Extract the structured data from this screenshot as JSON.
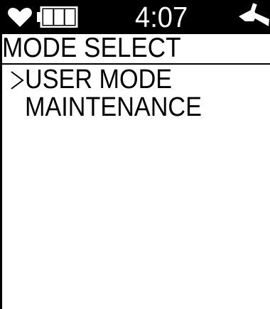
{
  "status_bar": {
    "time": "4:07",
    "icons": {
      "heart": "heart-icon",
      "battery": "battery-icon",
      "signal": "signal-icon"
    },
    "battery_level_bars": 3,
    "battery_level_max": 3
  },
  "screen": {
    "title": "MODE SELECT",
    "menu": [
      {
        "label": "USER MODE",
        "selected": true
      },
      {
        "label": "MAINTENANCE",
        "selected": false
      }
    ],
    "cursor_glyph": ">"
  },
  "colors": {
    "background": "#ffffff",
    "foreground": "#000000",
    "status_bar_bg": "#000000",
    "status_bar_fg": "#ffffff"
  }
}
